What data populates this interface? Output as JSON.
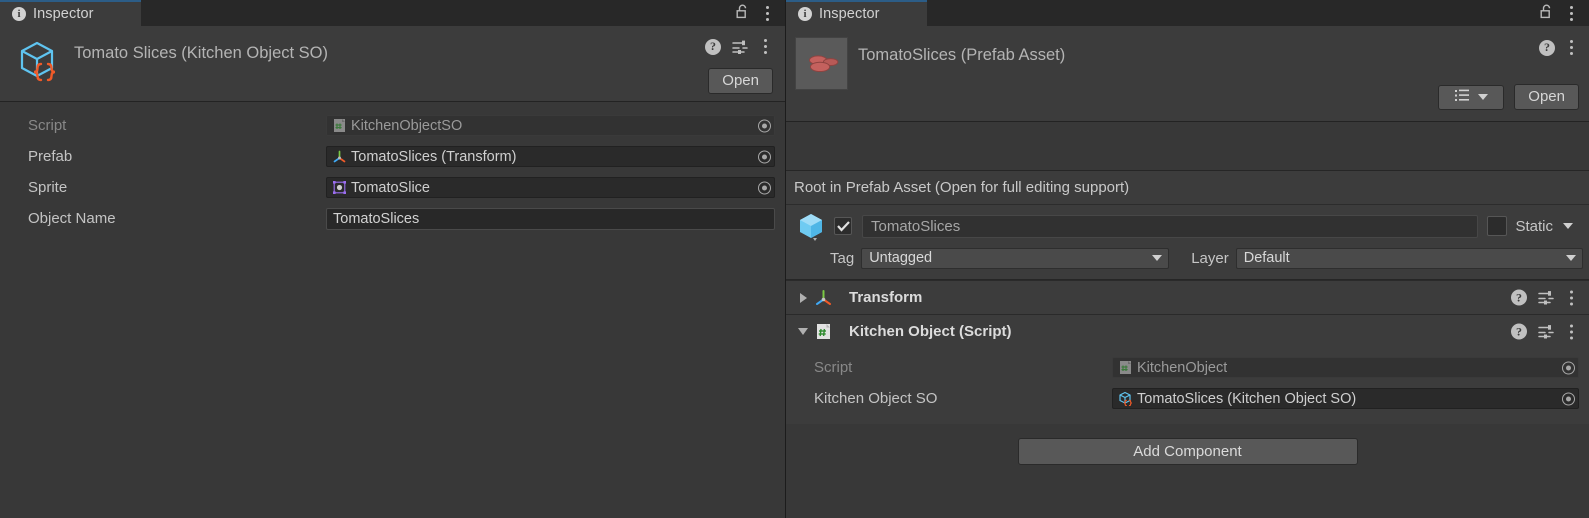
{
  "left_panel": {
    "tab": {
      "label": "Inspector",
      "icon": "info-icon"
    },
    "tabbar_icons": {
      "lock": "unlocked-padlock-icon",
      "menu": "kebab-menu-icon"
    },
    "asset": {
      "title": "Tomato Slices (Kitchen Object SO)",
      "icon": "scriptable-object-icon",
      "help_icon": "help-icon",
      "preset_icon": "preset-sliders-icon",
      "menu_icon": "kebab-menu-icon",
      "open_button": "Open"
    },
    "fields": [
      {
        "label": "Script",
        "value": "KitchenObjectSO",
        "icon": "cs-script-icon",
        "type": "object",
        "disabled": true
      },
      {
        "label": "Prefab",
        "value": "TomatoSlices (Transform)",
        "icon": "transform-icon",
        "type": "object",
        "disabled": false
      },
      {
        "label": "Sprite",
        "value": "TomatoSlice",
        "icon": "sprite-icon",
        "type": "object",
        "disabled": false
      },
      {
        "label": "Object Name",
        "value": "TomatoSlices",
        "icon": "",
        "type": "text",
        "disabled": false
      }
    ]
  },
  "right_panel": {
    "tab": {
      "label": "Inspector",
      "icon": "info-icon"
    },
    "tabbar_icons": {
      "lock": "unlocked-padlock-icon",
      "menu": "kebab-menu-icon"
    },
    "prefab": {
      "title": "TomatoSlices (Prefab Asset)",
      "thumbnail": "tomato-slices-thumbnail",
      "help_icon": "help-icon",
      "menu_icon": "kebab-menu-icon",
      "list_dropdown_icon": "list-view-icon",
      "open_button": "Open"
    },
    "prefab_note": "Root in Prefab Asset (Open for full editing support)",
    "gameobject": {
      "icon": "gameobject-prefab-icon",
      "enabled": true,
      "name": "TomatoSlices",
      "static_checked": false,
      "static_label": "Static",
      "tag_label": "Tag",
      "tag_value": "Untagged",
      "layer_label": "Layer",
      "layer_value": "Default"
    },
    "components": [
      {
        "title": "Transform",
        "icon": "transform-icon",
        "expanded": false,
        "help_icon": "help-icon",
        "preset_icon": "preset-sliders-icon",
        "menu_icon": "kebab-menu-icon",
        "fields": []
      },
      {
        "title": "Kitchen Object (Script)",
        "icon": "cs-script-icon",
        "expanded": true,
        "help_icon": "help-icon",
        "preset_icon": "preset-sliders-icon",
        "menu_icon": "kebab-menu-icon",
        "fields": [
          {
            "label": "Script",
            "value": "KitchenObject",
            "icon": "cs-script-icon",
            "disabled": true
          },
          {
            "label": "Kitchen Object SO",
            "value": "TomatoSlices (Kitchen Object SO)",
            "icon": "scriptable-object-icon",
            "disabled": false
          }
        ]
      }
    ],
    "add_component_button": "Add Component"
  },
  "colors": {
    "window_bg": "#383838",
    "panel_bg": "#3c3c3c",
    "tabbar_bg": "#282828",
    "accent_blue": "#2c5d87",
    "field_bg": "#2a2a2a",
    "button_bg": "#585858",
    "text": "#c4c4c4",
    "text_dim": "#888888",
    "icon_blue": "#5fc4f0",
    "icon_orange": "#f05a28"
  }
}
